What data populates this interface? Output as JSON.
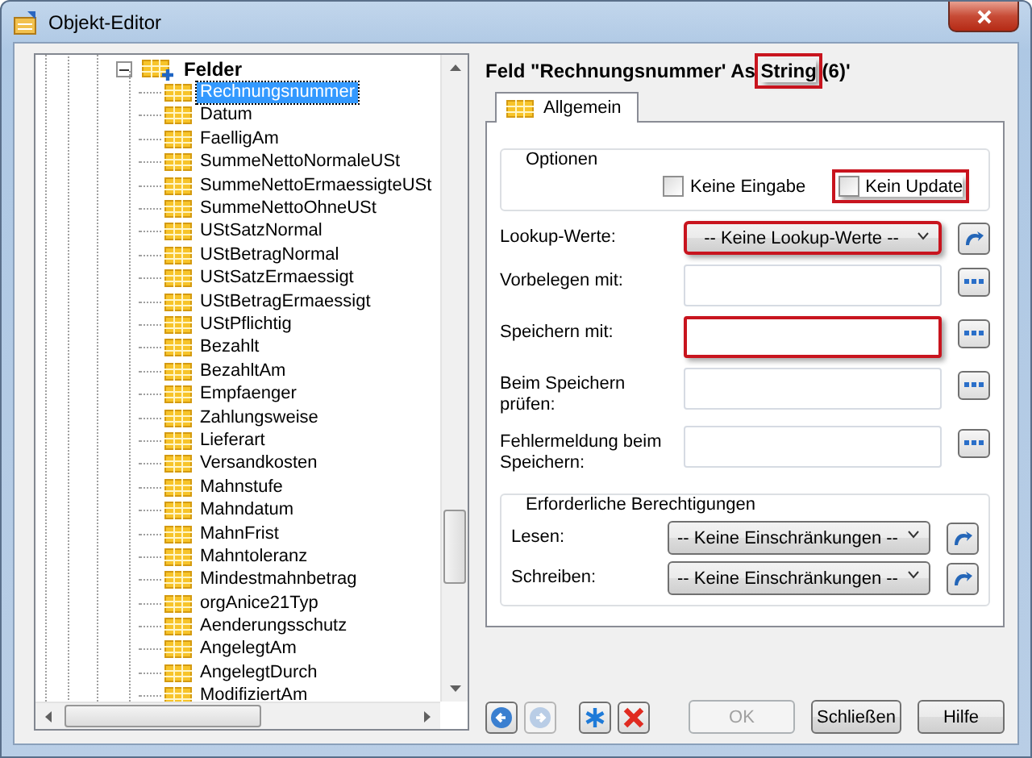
{
  "window": {
    "title": "Objekt-Editor"
  },
  "tree": {
    "label": "Felder",
    "expanded": true,
    "children": [
      {
        "label": "Rechnungsnummer",
        "selected": true
      },
      {
        "label": "Datum",
        "selected": false
      },
      {
        "label": "FaelligAm",
        "selected": false
      },
      {
        "label": "SummeNettoNormaleUSt",
        "selected": false
      },
      {
        "label": "SummeNettoErmaessigteUSt",
        "selected": false
      },
      {
        "label": "SummeNettoOhneUSt",
        "selected": false
      },
      {
        "label": "UStSatzNormal",
        "selected": false
      },
      {
        "label": "UStBetragNormal",
        "selected": false
      },
      {
        "label": "UStSatzErmaessigt",
        "selected": false
      },
      {
        "label": "UStBetragErmaessigt",
        "selected": false
      },
      {
        "label": "UStPflichtig",
        "selected": false
      },
      {
        "label": "Bezahlt",
        "selected": false
      },
      {
        "label": "BezahltAm",
        "selected": false
      },
      {
        "label": "Empfaenger",
        "selected": false
      },
      {
        "label": "Zahlungsweise",
        "selected": false
      },
      {
        "label": "Lieferart",
        "selected": false
      },
      {
        "label": "Versandkosten",
        "selected": false
      },
      {
        "label": "Mahnstufe",
        "selected": false
      },
      {
        "label": "Mahndatum",
        "selected": false
      },
      {
        "label": "MahnFrist",
        "selected": false
      },
      {
        "label": "Mahntoleranz",
        "selected": false
      },
      {
        "label": "Mindestmahnbetrag",
        "selected": false
      },
      {
        "label": "orgAnice21Typ",
        "selected": false
      },
      {
        "label": "Aenderungsschutz",
        "selected": false
      },
      {
        "label": "AngelegtAm",
        "selected": false
      },
      {
        "label": "AngelegtDurch",
        "selected": false
      },
      {
        "label": "ModifiziertAm",
        "selected": false
      }
    ]
  },
  "heading": [
    {
      "text": "Feld \"Rechnungsnummer' As ",
      "highlighted": false
    },
    {
      "text": "String",
      "highlighted": true
    },
    {
      "text": " (6)'",
      "highlighted": false
    }
  ],
  "tabs": [
    {
      "label": "Allgemein",
      "selected": true
    }
  ],
  "options": {
    "title": "Optionen",
    "checkboxes": [
      {
        "label": "Keine Eingabe",
        "checked": false,
        "highlighted": false
      },
      {
        "label": "Kein Update",
        "checked": false,
        "highlighted": true
      }
    ]
  },
  "rows": [
    {
      "kind": "dropdown",
      "label": "Lookup-Werte:",
      "value": "-- Keine Lookup-Werte --",
      "highlighted": true
    },
    {
      "kind": "text",
      "label": "Vorbelegen mit:",
      "highlighted": false
    },
    {
      "kind": "text",
      "label": "Speichern mit:",
      "highlighted": true
    },
    {
      "kind": "text",
      "label": "Beim Speichern prüfen:",
      "highlighted": false
    },
    {
      "kind": "text",
      "label": "Fehlermeldung beim Speichern:",
      "highlighted": false
    }
  ],
  "permissions": {
    "title": "Erforderliche Berechtigungen",
    "rows": [
      {
        "label": "Lesen:",
        "value": "-- Keine Einschränkungen --"
      },
      {
        "label": "Schreiben:",
        "value": "-- Keine Einschränkungen --"
      }
    ]
  },
  "toolbar": [
    {
      "kind": "back",
      "disabled": false
    },
    {
      "kind": "forward",
      "disabled": true
    },
    {
      "kind": "new",
      "disabled": false
    },
    {
      "kind": "delete",
      "disabled": false
    }
  ],
  "buttons": [
    {
      "label": "OK",
      "disabled": true
    },
    {
      "label": "Schließen",
      "disabled": false
    },
    {
      "label": "Hilfe",
      "disabled": false
    }
  ]
}
